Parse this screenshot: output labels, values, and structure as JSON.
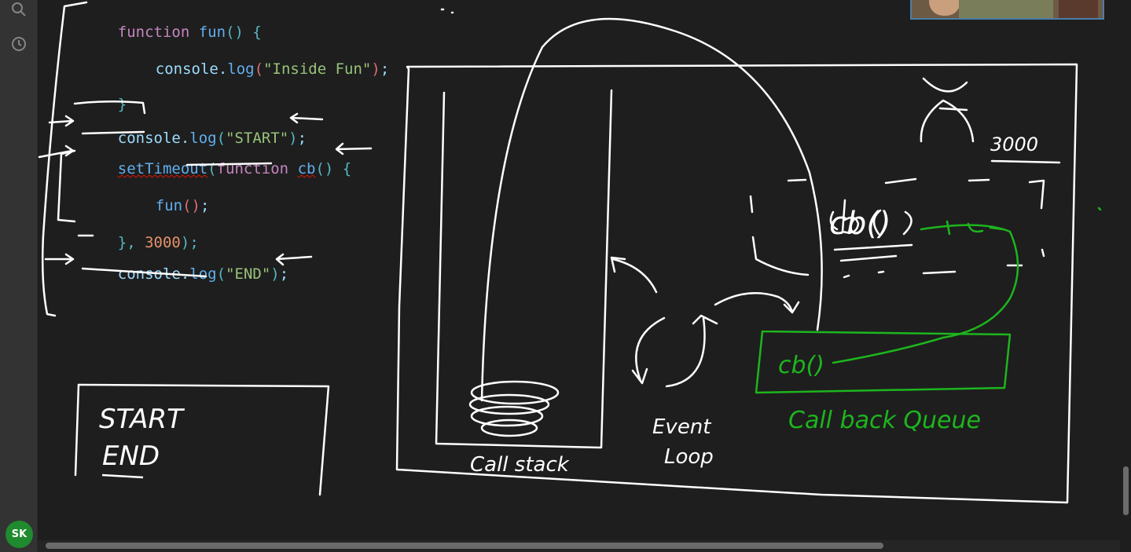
{
  "code": {
    "line1": {
      "kw": "function",
      "name": "fun",
      "tail": "() {"
    },
    "line2": {
      "obj": "console",
      "dot": ".",
      "method": "log",
      "open": "(",
      "str": "\"Inside Fun\"",
      "close": ")",
      "semi": ";"
    },
    "line3": {
      "brace": "}"
    },
    "line4": {
      "obj": "console",
      "dot": ".",
      "method": "log",
      "open": "(",
      "str": "\"START\"",
      "close": ")",
      "semi": ";"
    },
    "line5": {
      "name": "setTimeout",
      "open": "(",
      "kw": "function",
      "cb": "cb",
      "tail": "() {"
    },
    "line6": {
      "name": "fun",
      "parens": "()",
      "semi": ";"
    },
    "line7": {
      "brace": "},",
      "num": "3000",
      "close": ");"
    },
    "line8": {
      "obj": "console",
      "dot": ".",
      "method": "log",
      "open": "(",
      "str": "\"END\"",
      "close": ")",
      "semi": ";"
    }
  },
  "annotations": {
    "output": [
      "START",
      "END"
    ],
    "timer_value": "3000",
    "timer_cb": "cb()",
    "queue_item": "cb()",
    "call_stack_label": "Call stack",
    "event_loop_label_1": "Event",
    "event_loop_label_2": "Loop",
    "callback_queue_label": "Call back Queue"
  },
  "sidebar": {
    "search_icon": "search-icon",
    "timeline_icon": "clock-icon",
    "avatar_initials": "SK"
  },
  "colors": {
    "ink_white": "#ffffff",
    "ink_green": "#1db51d",
    "avatar_bg": "#1f8a2e"
  }
}
